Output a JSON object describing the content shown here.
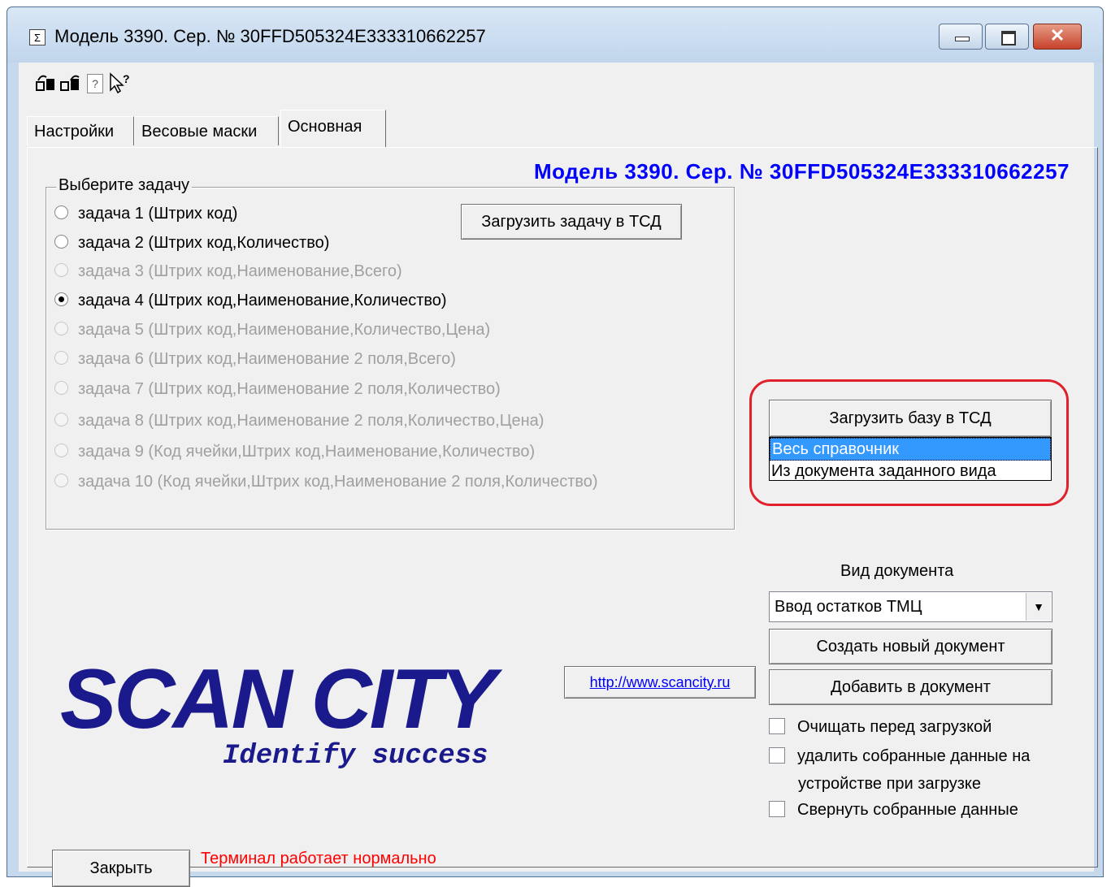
{
  "window": {
    "title": "Модель 3390. Сер. № 30FFD505324E333310662257",
    "controls": {
      "minimize": "minimize",
      "maximize": "maximize",
      "close": "✕"
    }
  },
  "toolbar": {
    "icons": [
      "connect-icon",
      "disconnect-icon",
      "help-icon",
      "context-help-icon"
    ],
    "help_glyph": "?",
    "context_help_glyph": "↖?"
  },
  "tabs": [
    {
      "label": "Настройки",
      "active": false
    },
    {
      "label": "Весовые маски",
      "active": false
    },
    {
      "label": "Основная",
      "active": true
    }
  ],
  "main": {
    "model_label": "Модель 3390. Сер. № 30FFD505324E333310662257",
    "task_group": {
      "legend": "Выберите задачу",
      "options": [
        {
          "label": "задача 1 (Штрих код)",
          "checked": false,
          "enabled": true
        },
        {
          "label": "задача 2 (Штрих код,Количество)",
          "checked": false,
          "enabled": true
        },
        {
          "label": "задача 3 (Штрих код,Наименование,Всего)",
          "checked": false,
          "enabled": false
        },
        {
          "label": "задача 4 (Штрих код,Наименование,Количество)",
          "checked": true,
          "enabled": true
        },
        {
          "label": "задача 5 (Штрих код,Наименование,Количество,Цена)",
          "checked": false,
          "enabled": false
        },
        {
          "label": "задача 6 (Штрих код,Наименование 2 поля,Всего)",
          "checked": false,
          "enabled": false
        },
        {
          "label": "задача 7 (Штрих код,Наименование 2 поля,Количество)",
          "checked": false,
          "enabled": false
        },
        {
          "label": "задача 8 (Штрих код,Наименование 2 поля,Количество,Цена)",
          "checked": false,
          "enabled": false
        },
        {
          "label": "задача 9 (Код ячейки,Штрих код,Наименование,Количество)",
          "checked": false,
          "enabled": false
        },
        {
          "label": "задача 10 (Код ячейки,Штрих код,Наименование 2 поля,Количество)",
          "checked": false,
          "enabled": false
        }
      ]
    },
    "load_task_button": "Загрузить задачу в ТСД",
    "load_db_button": "Загрузить базу в ТСД",
    "db_source_list": {
      "items": [
        "Весь справочник",
        "Из документа заданного вида"
      ],
      "selected": "Весь справочник"
    },
    "highlight_color": "#e0202a",
    "doc_type_label": "Вид документа",
    "doc_type_select": {
      "value": "Ввод остатков ТМЦ",
      "arrow": "▼"
    },
    "create_doc_button": "Создать новый документ",
    "add_to_doc_button": "Добавить в документ",
    "checkboxes": [
      {
        "label": "Очищать перед загрузкой",
        "checked": false
      },
      {
        "label": "удалить собранные данные на",
        "label2": "устройстве при загрузке",
        "checked": false
      },
      {
        "label": "Свернуть собранные данные",
        "checked": false
      }
    ],
    "site_link": "http://www.scancity.ru",
    "logo_title": "SCAN CITY",
    "logo_subtitle": "Identify success",
    "close_button": "Закрыть",
    "status_text": "Терминал работает нормально",
    "colors": {
      "model_label": "#0000ff",
      "status": "#ff0000",
      "logo": "#1a1a8c",
      "selection": "#3399ff"
    }
  }
}
